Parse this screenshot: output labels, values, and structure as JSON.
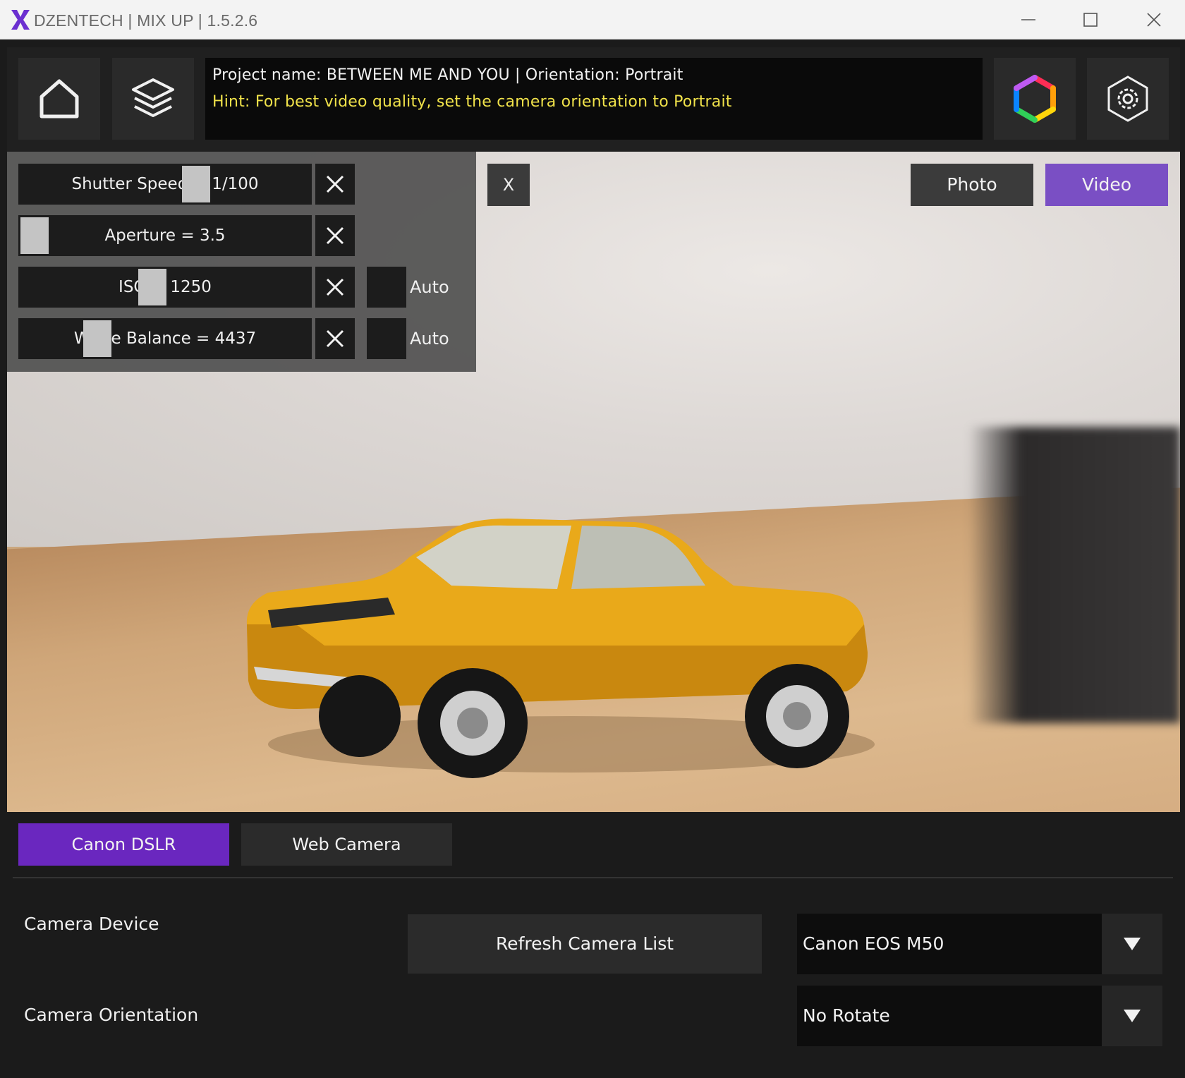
{
  "window": {
    "title": "DZENTECH | MIX UP | 1.5.2.6",
    "logo_icon": "mixup-x-logo"
  },
  "header": {
    "project_line": "Project name: BETWEEN ME AND YOU | Orientation: Portrait",
    "hint_line": "Hint: For best video quality, set the camera orientation to Portrait"
  },
  "camera_settings": {
    "shutter": {
      "label": "Shutter Speed = 1/100",
      "position": 0.62
    },
    "aperture": {
      "label": "Aperture = 3.5",
      "position": 0.0
    },
    "iso": {
      "label": "ISO = 1250",
      "position": 0.45,
      "auto_label": "Auto"
    },
    "white_balance": {
      "label": "White Balance = 4437",
      "position": 0.24,
      "auto_label": "Auto"
    }
  },
  "view": {
    "close_label": "X",
    "photo_label": "Photo",
    "video_label": "Video"
  },
  "tabs": {
    "dslr_label": "Canon DSLR",
    "web_label": "Web Camera"
  },
  "device": {
    "label": "Camera Device",
    "refresh_label": "Refresh Camera List",
    "selected": "Canon EOS M50"
  },
  "orientation": {
    "label": "Camera Orientation",
    "selected": "No Rotate"
  },
  "colors": {
    "accent_purple": "#6a27bf",
    "video_purple": "#7a4fc4",
    "hint_yellow": "#f0e24a"
  }
}
